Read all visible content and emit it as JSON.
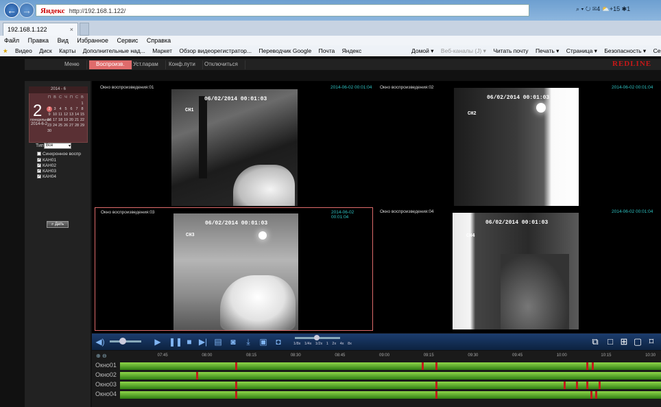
{
  "browser": {
    "address": "http://192.168.1.122/",
    "address_logo": "Яндекс",
    "tab_title": "192.168.1.122",
    "right_tools": "⌕ ▾ ↻  ✉4 ⛅+15 ✱1",
    "menu": [
      "Файл",
      "Правка",
      "Вид",
      "Избранное",
      "Сервис",
      "Справка"
    ],
    "favorites": [
      "Видео",
      "Диск",
      "Карты",
      "Дополнительные над...",
      "Маркет",
      "Обзор видеорегистратор...",
      "Переводчик Google",
      "Почта",
      "Яндекс"
    ],
    "toolbar_right": [
      "Домой ▾",
      "Веб-каналы (J) ▾",
      "Читать почту",
      "Печать ▾",
      "Страница ▾",
      "Безопасность ▾",
      "Сервис ▾"
    ]
  },
  "app": {
    "brand": "REDLINE",
    "nav": [
      {
        "label": "Меню",
        "active": false
      },
      {
        "label": "Воспроизв.",
        "active": true
      },
      {
        "label": "Уст.парам",
        "active": false
      },
      {
        "label": "Конф.пути",
        "active": false
      },
      {
        "label": "Отключиться",
        "active": false
      }
    ],
    "calendar": {
      "header": "2014 - 6",
      "day": "2",
      "weekday": "понедельник",
      "date": "2014-6-2",
      "weekdays": [
        "П",
        "В",
        "С",
        "Ч",
        "П",
        "С",
        "В"
      ],
      "rows": [
        [
          "",
          "",
          "",
          "",
          "",
          "",
          "1"
        ],
        [
          "2",
          "3",
          "4",
          "5",
          "6",
          "7",
          "8"
        ],
        [
          "9",
          "10",
          "11",
          "12",
          "13",
          "14",
          "15"
        ],
        [
          "16",
          "17",
          "18",
          "19",
          "20",
          "21",
          "22"
        ],
        [
          "23",
          "24",
          "25",
          "26",
          "27",
          "28",
          "29"
        ],
        [
          "30",
          "",
          "",
          "",
          "",
          "",
          ""
        ]
      ]
    },
    "type_label": "Тип",
    "type_value": "Все",
    "checkboxes": [
      "Синхронное воспр",
      "КАН01",
      "КАН02",
      "КАН03",
      "КАН04"
    ],
    "search_label": "Дать",
    "panes": [
      {
        "title": "Окно воспроизведения:01",
        "time": "2014-06-02 00:01:04",
        "osd": "06/02/2014 00:01:03",
        "ch": "CH1",
        "selected": false
      },
      {
        "title": "Окно воспроизведения:02",
        "time": "2014-06-02 00:01:04",
        "osd": "06/02/2014 00:01:03",
        "ch": "CH2",
        "selected": false
      },
      {
        "title": "Окно воспроизведения:03",
        "time": "2014-06-02 00:01:04",
        "osd": "06/02/2014 00:01:03",
        "ch": "CH3",
        "selected": true
      },
      {
        "title": "Окно воспроизведения:04",
        "time": "2014-06-02 00:01:04",
        "osd": "06/02/2014 00:01:03",
        "ch": "CH4",
        "selected": false
      }
    ],
    "speeds": [
      "1/8x",
      "1/4x",
      "1/2x",
      "1",
      "2x",
      "4x",
      "8x"
    ],
    "timeline": {
      "ticks": [
        "07:45",
        "08:00",
        "08:15",
        "08:30",
        "08:45",
        "09:00",
        "09:15",
        "09:30",
        "09:45",
        "10:00",
        "10:15",
        "10:30"
      ],
      "rows": [
        {
          "label": "Окно01",
          "marks": [
            8.15,
            9.2,
            9.28,
            10.13,
            10.16
          ]
        },
        {
          "label": "Окно02",
          "marks": [
            7.93
          ]
        },
        {
          "label": "Окно03",
          "marks": [
            8.15,
            9.28,
            10.0,
            10.07,
            10.13,
            10.2
          ]
        },
        {
          "label": "Окно04",
          "marks": [
            8.15,
            9.28,
            10.15,
            10.18
          ]
        }
      ]
    }
  },
  "colors": {
    "accent": "#e06b6b",
    "brand": "#c71818",
    "track": "#5fae2c",
    "mark": "#c51b1b",
    "time": "#2ec4c4"
  }
}
